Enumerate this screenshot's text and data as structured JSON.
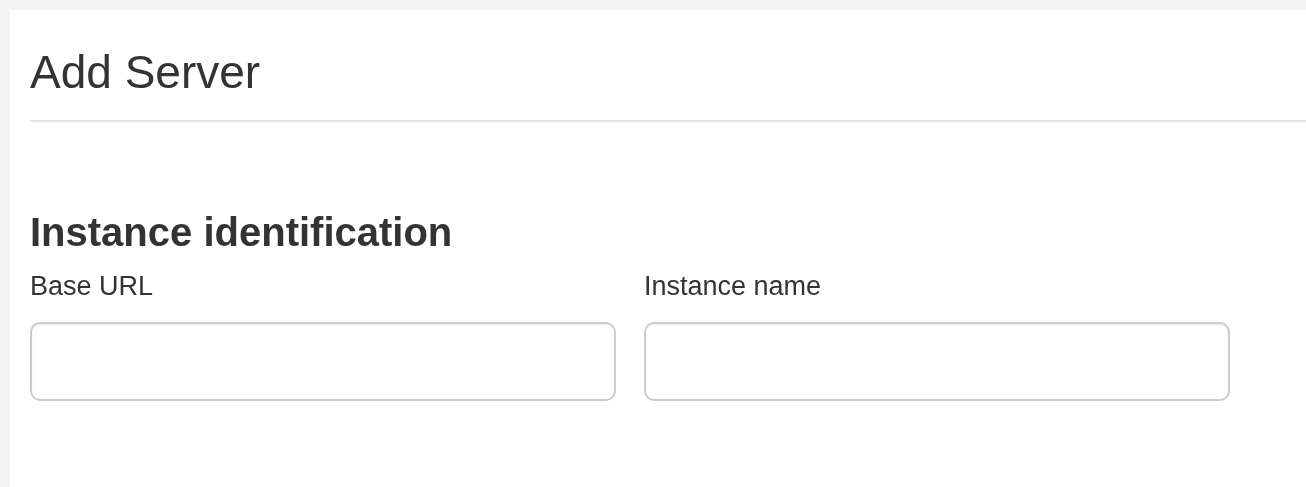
{
  "title": "Add Server",
  "section": {
    "heading": "Instance identification",
    "fields": [
      {
        "label": "Base URL"
      },
      {
        "label": "Instance name"
      }
    ]
  }
}
